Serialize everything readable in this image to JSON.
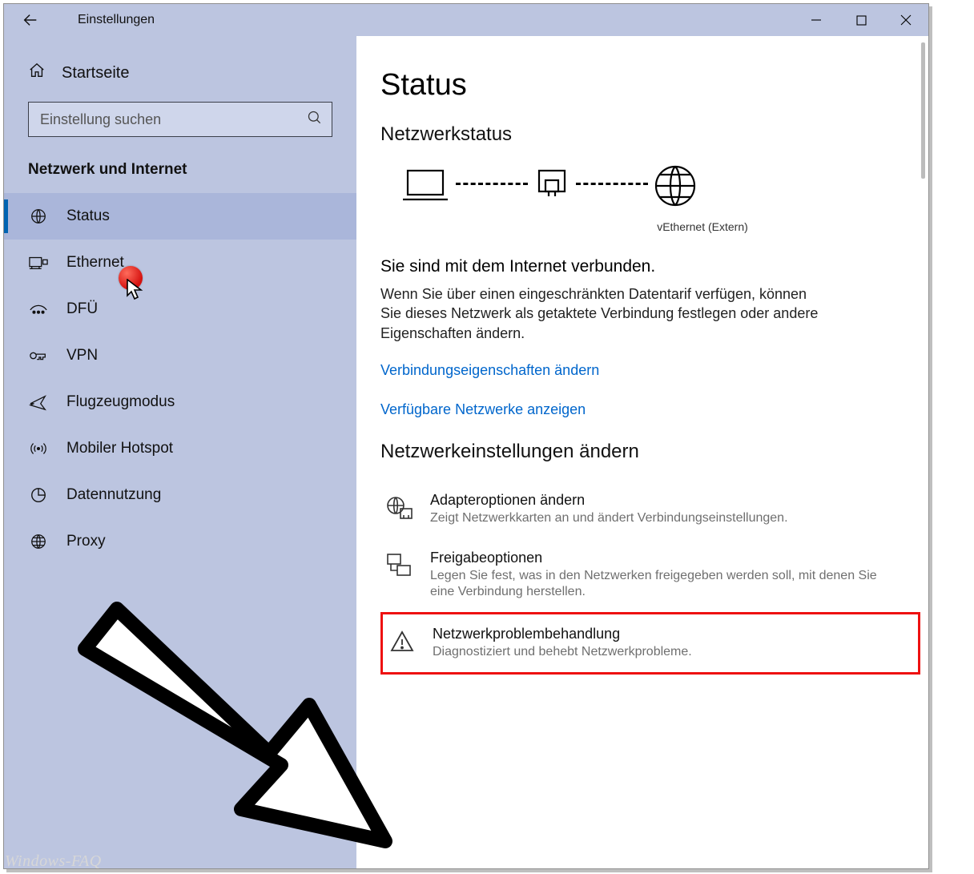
{
  "window": {
    "title": "Einstellungen"
  },
  "sidebar": {
    "home": "Startseite",
    "search_placeholder": "Einstellung suchen",
    "group_title": "Netzwerk und Internet",
    "items": [
      {
        "label": "Status",
        "icon": "globe-grid-icon",
        "selected": true
      },
      {
        "label": "Ethernet",
        "icon": "ethernet-icon",
        "selected": false
      },
      {
        "label": "DFÜ",
        "icon": "dialup-icon",
        "selected": false
      },
      {
        "label": "VPN",
        "icon": "vpn-icon",
        "selected": false
      },
      {
        "label": "Flugzeugmodus",
        "icon": "airplane-icon",
        "selected": false
      },
      {
        "label": "Mobiler Hotspot",
        "icon": "hotspot-icon",
        "selected": false
      },
      {
        "label": "Datennutzung",
        "icon": "data-usage-icon",
        "selected": false
      },
      {
        "label": "Proxy",
        "icon": "globe-icon",
        "selected": false
      }
    ]
  },
  "main": {
    "page_title": "Status",
    "section1_title": "Netzwerkstatus",
    "diagram_adapter_label": "vEthernet (Extern)",
    "connected_title": "Sie sind mit dem Internet verbunden.",
    "connected_text": "Wenn Sie über einen eingeschränkten Datentarif verfügen, können Sie dieses Netzwerk als getaktete Verbindung festlegen oder andere Eigenschaften ändern.",
    "link_change_props": "Verbindungseigenschaften ändern",
    "link_show_networks": "Verfügbare Netzwerke anzeigen",
    "section2_title": "Netzwerkeinstellungen ändern",
    "options": [
      {
        "title": "Adapteroptionen ändern",
        "desc": "Zeigt Netzwerkkarten an und ändert Verbindungseinstellungen.",
        "icon": "adapter-icon"
      },
      {
        "title": "Freigabeoptionen",
        "desc": "Legen Sie fest, was in den Netzwerken freigegeben werden soll, mit denen Sie eine Verbindung herstellen.",
        "icon": "sharing-icon"
      },
      {
        "title": "Netzwerkproblembehandlung",
        "desc": "Diagnostiziert und behebt Netzwerkprobleme.",
        "icon": "troubleshoot-icon",
        "highlighted": true
      }
    ]
  },
  "watermark": "Windows-FAQ",
  "colors": {
    "accent": "#0063b1",
    "link": "#0066cc",
    "sidebar_bg": "#bcc5e0",
    "highlight": "#e11"
  }
}
